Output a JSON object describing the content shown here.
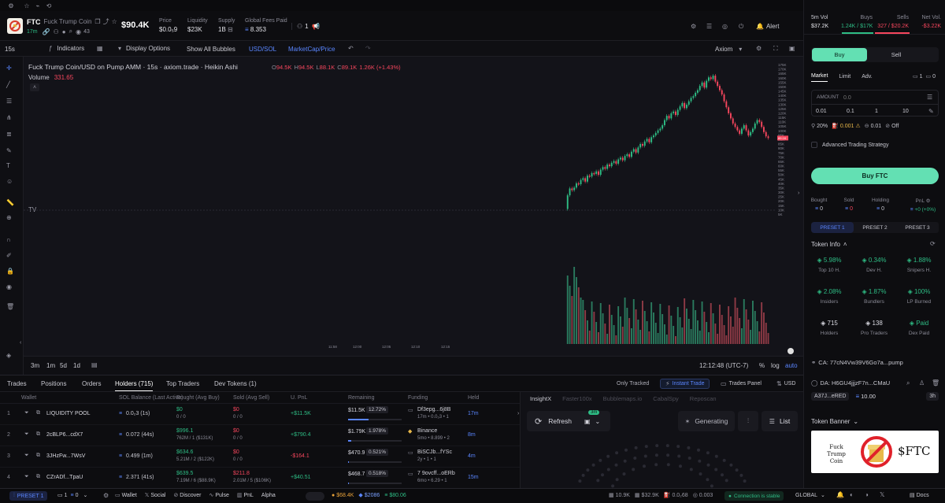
{
  "token": {
    "ticker": "FTC",
    "name": "Fuck Trump Coin",
    "age": "17m",
    "holders_small": "43",
    "market_cap": "$90.4K"
  },
  "stats": [
    {
      "label": "Price",
      "value": "$0.0₅9"
    },
    {
      "label": "Liquidity",
      "value": "$23K"
    },
    {
      "label": "Supply",
      "value": "1B"
    },
    {
      "label": "Global Fees Paid",
      "value": "8.353"
    }
  ],
  "topbar": {
    "counter": "1",
    "alert": "Alert"
  },
  "volstats": [
    {
      "label": "5m Vol",
      "value": "$37.2K"
    },
    {
      "label": "Buys",
      "value": "1.24K / $17K"
    },
    {
      "label": "Sells",
      "value": "327 / $20.2K"
    },
    {
      "label": "Net Vol.",
      "value": "-$3.22K"
    }
  ],
  "charttoolbar": {
    "interval": "15s",
    "indicators": "Indicators",
    "display": "Display Options",
    "bubbles": "Show All Bubbles",
    "currency": "USD/SOL",
    "mode": "MarketCap/Price",
    "source": "Axiom"
  },
  "chart": {
    "legend_title": "Fuck Trump Coin/USD on Pump AMM · 15s · axiom.trade · Heikin Ashi",
    "o": "94.5K",
    "h": "94.5K",
    "l": "88.1K",
    "c": "89.1K",
    "chg": "1.26K (+1.43%)",
    "volume_label": "Volume",
    "volume_value": "331.65",
    "yticks": [
      "175K",
      "170K",
      "165K",
      "160K",
      "155K",
      "150K",
      "145K",
      "140K",
      "135K",
      "130K",
      "125K",
      "120K",
      "115K",
      "110K",
      "105K",
      "100K",
      "95K",
      "90K",
      "85K",
      "80K",
      "75K",
      "70K",
      "65K",
      "60K",
      "55K",
      "50K",
      "45K",
      "40K",
      "35K",
      "30K",
      "25K",
      "20K",
      "15K",
      "10K",
      "5K"
    ],
    "xticks": [
      "11:58",
      "12:00",
      "12:05",
      "12:10",
      "12:15"
    ],
    "last_price": "89.1K"
  },
  "chart_data": {
    "type": "candlestick",
    "series": [
      {
        "values": [
          6,
          22,
          30,
          28,
          31,
          36,
          35,
          40,
          42,
          38,
          45,
          44,
          48,
          47,
          50,
          46,
          52,
          55,
          53,
          58,
          56,
          60,
          62,
          59,
          64,
          66,
          63,
          68,
          70,
          67,
          73,
          76,
          72,
          78,
          82,
          80,
          85,
          88,
          84,
          90,
          92,
          95,
          98,
          100,
          104,
          110,
          115,
          112,
          118,
          120,
          116,
          122,
          126,
          130,
          124,
          128,
          132,
          136,
          138,
          142,
          145,
          150,
          154,
          148,
          156,
          160,
          158,
          162,
          155,
          150,
          145,
          140,
          132,
          125,
          118,
          112,
          106,
          102,
          98,
          94,
          100,
          104,
          98,
          92,
          96,
          100,
          106,
          110,
          108,
          102,
          96,
          91,
          89
        ]
      }
    ],
    "ylim": [
      0,
      175000
    ]
  },
  "chartbottom": {
    "ranges": [
      "3m",
      "1m",
      "5d",
      "1d"
    ],
    "time": "12:12:48 (UTC-7)",
    "pct": "%",
    "log": "log",
    "auto": "auto"
  },
  "tabs": [
    "Trades",
    "Positions",
    "Orders",
    "Holders (715)",
    "Top Traders",
    "Dev Tokens (1)"
  ],
  "tabs_right": {
    "only_tracked": "Only Tracked",
    "instant": "Instant Trade",
    "panel": "Trades Panel",
    "usd": "USD"
  },
  "table": {
    "headers": [
      "Wallet",
      "SOL Balance (Last Active)",
      "Bought (Avg Buy)",
      "Sold (Avg Sell)",
      "U. PnL",
      "Remaining",
      "Funding",
      "Held"
    ],
    "rows": [
      {
        "n": "1",
        "wallet": "LIQUIDITY POOL",
        "sol": "0.0₂3 (1s)",
        "bought": "$0",
        "bought2": "0 / 0",
        "sold": "$0",
        "sold2": "0 / 0",
        "pnl": "+$11.5K",
        "rem": "$11.5K",
        "rempct": "12.72%",
        "fund": "Df3epg...6j8B",
        "fund2": "17m • 0.0₂3 • 1",
        "held": "17m"
      },
      {
        "n": "2",
        "wallet": "2cBLP6...cdX7",
        "sol": "0.072 (44s)",
        "bought": "$996.1",
        "bought2": "762M / 1 ($131K)",
        "sold": "$0",
        "sold2": "0 / 0",
        "pnl": "+$790.4",
        "rem": "$1.79K",
        "rempct": "1.978%",
        "fund": "Binance",
        "fund2": "5mo • 8.899 • 2",
        "held": "8m"
      },
      {
        "n": "3",
        "wallet": "3JHzFw...7WsV",
        "sol": "0.499 (1m)",
        "bought": "$634.6",
        "bought2": "5.21M / 2 ($122K)",
        "sold": "$0",
        "sold2": "0 / 0",
        "pnl": "-$164.1",
        "rem": "$470.9",
        "rempct": "0.521%",
        "fund": "BiSCJb...fYSc",
        "fund2": "2y • 1 • 1",
        "held": "4m"
      },
      {
        "n": "4",
        "wallet": "CZrADf...TpaU",
        "sol": "2.371 (41s)",
        "bought": "$639.5",
        "bought2": "7.19M / 6 ($88.9K)",
        "sold": "$211.8",
        "sold2": "2.01M / 5 ($106K)",
        "pnl": "+$40.51",
        "rem": "$468.7",
        "rempct": "0.518%",
        "fund": "7 9ovcff...oERb",
        "fund2": "6mo • 6.29 • 1",
        "held": "15m"
      }
    ]
  },
  "insight": {
    "tabs": [
      "InsightX",
      "Faster100x",
      "Bubblemaps.io",
      "CabalSpy",
      "Reposcan"
    ],
    "refresh": "Refresh",
    "badge": "3m",
    "generating": "Generating",
    "list": "List"
  },
  "right": {
    "buy": "Buy",
    "sell": "Sell",
    "ordertabs": [
      "Market",
      "Limit",
      "Adv."
    ],
    "counts": {
      "a": "1",
      "b": "0"
    },
    "amount_label": "AMOUNT",
    "amount_placeholder": "0.0",
    "amounts": [
      "0.01",
      "0.1",
      "1",
      "10"
    ],
    "settings": {
      "slip": "20%",
      "prio": "0.001",
      "bribe": "0.01",
      "mev": "Off"
    },
    "adv": "Advanced Trading Strategy",
    "buy_btn": "Buy FTC",
    "pos": [
      {
        "label": "Bought",
        "value": "0"
      },
      {
        "label": "Sold",
        "value": "0"
      },
      {
        "label": "Holding",
        "value": "0"
      },
      {
        "label": "PnL",
        "value": "+0 (+0%)"
      }
    ],
    "presets": [
      "PRESET 1",
      "PRESET 2",
      "PRESET 3"
    ],
    "tokeninfo": "Token Info",
    "info": [
      {
        "value": "5.98%",
        "label": "Top 10 H.",
        "cls": "green"
      },
      {
        "value": "0.34%",
        "label": "Dev H.",
        "cls": "green"
      },
      {
        "value": "1.88%",
        "label": "Snipers H.",
        "cls": "green"
      },
      {
        "value": "2.08%",
        "label": "Insiders",
        "cls": "green"
      },
      {
        "value": "1.87%",
        "label": "Bundlers",
        "cls": "green"
      },
      {
        "value": "100%",
        "label": "LP Burned",
        "cls": "green"
      },
      {
        "value": "715",
        "label": "Holders",
        "cls": "white"
      },
      {
        "value": "138",
        "label": "Pro Traders",
        "cls": "white"
      },
      {
        "value": "Paid",
        "label": "Dex Paid",
        "cls": "green"
      }
    ],
    "ca": "CA: 77cN4Vw39V6Go7a...pump",
    "da": "DA: H6GU4jjjzF7n...CMaU",
    "dev": "A37J...eRED",
    "devval": "10.00",
    "devage": "3h",
    "banner_label": "Token Banner",
    "banner_name": "Fuck Trump Coin",
    "banner_ticker": "$FTC"
  },
  "bottom": {
    "preset": "PRESET 1",
    "a": "1",
    "b": "0",
    "items": [
      "Wallet",
      "Social",
      "Discover",
      "Pulse",
      "PnL",
      "Alpha"
    ],
    "btc": "$68.4K",
    "eth": "$2086",
    "sol": "$80.06",
    "s1": "10.9K",
    "s2": "$32.9K",
    "s3": "0.0₂68",
    "s4": "0.003",
    "conn": "Connection is stable",
    "region": "GLOBAL",
    "docs": "Docs"
  }
}
